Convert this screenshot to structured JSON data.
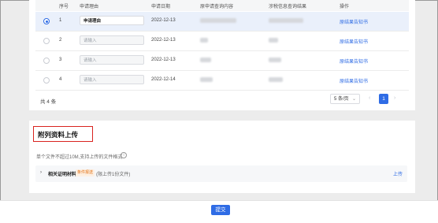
{
  "table": {
    "headers": [
      "序号",
      "申请理由",
      "申请日期",
      "原申请查询内容",
      "涉税信息查询结果",
      "操作"
    ],
    "rows": [
      {
        "index": "1",
        "reason_value": "申请理由",
        "reason_placeholder": "",
        "date": "2022-12-13",
        "action": "原结果告知书",
        "selected": true
      },
      {
        "index": "2",
        "reason_value": "",
        "reason_placeholder": "请输入",
        "date": "2022-12-13",
        "action": "原结果告知书",
        "selected": false
      },
      {
        "index": "3",
        "reason_value": "",
        "reason_placeholder": "请输入",
        "date": "2022-12-13",
        "action": "原结果告知书",
        "selected": false
      },
      {
        "index": "4",
        "reason_value": "",
        "reason_placeholder": "请输入",
        "date": "2022-12-14",
        "action": "原结果告知书",
        "selected": false
      }
    ]
  },
  "pagination": {
    "total": "共 4 条",
    "page_size": "5 条/页",
    "prev": "‹",
    "current_page": "1",
    "next": "›"
  },
  "upload_section": {
    "title": "附列资料上传",
    "hint": "单个文件不超过10M,支持上传的文件格式",
    "info_icon": "ⓘ",
    "item": {
      "caret": "›",
      "label": "相关证明材料",
      "tag": "条件报送",
      "note": "(限上传1份文件)",
      "upload": "上传"
    }
  },
  "footer": {
    "submit_label": "提交"
  }
}
